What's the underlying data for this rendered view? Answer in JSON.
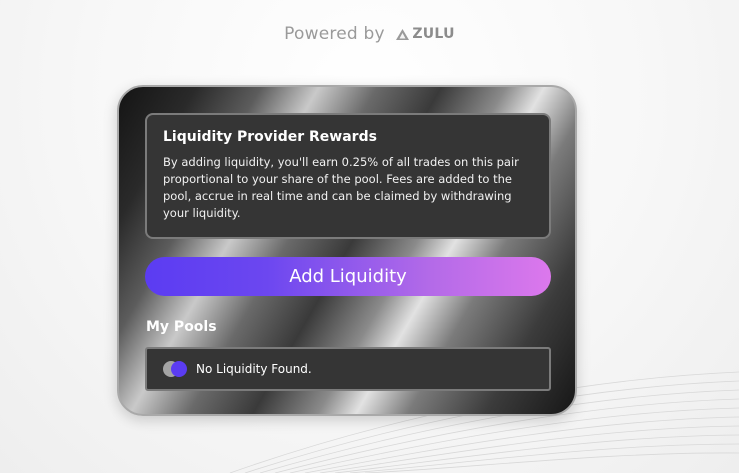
{
  "header": {
    "powered_label": "Powered by",
    "brand_name": "ZULU",
    "brand_icon": "zulu-logo-icon"
  },
  "rewards": {
    "title": "Liquidity Provider Rewards",
    "description": "By adding liquidity, you'll earn 0.25% of all trades on this pair proportional to your share of the pool. Fees are added to the pool, accrue in real time and can be claimed by withdrawing your liquidity."
  },
  "actions": {
    "add_liquidity_label": "Add Liquidity"
  },
  "pools": {
    "heading": "My Pools",
    "empty_message": "No Liquidity Found.",
    "pair_icon": "token-pair-icon"
  },
  "colors": {
    "button_gradient_start": "#5b3cf2",
    "button_gradient_end": "#dc78ec",
    "panel_bg": "#353535",
    "panel_border": "#7b7b7b",
    "powered_text": "#9a9a9a"
  }
}
